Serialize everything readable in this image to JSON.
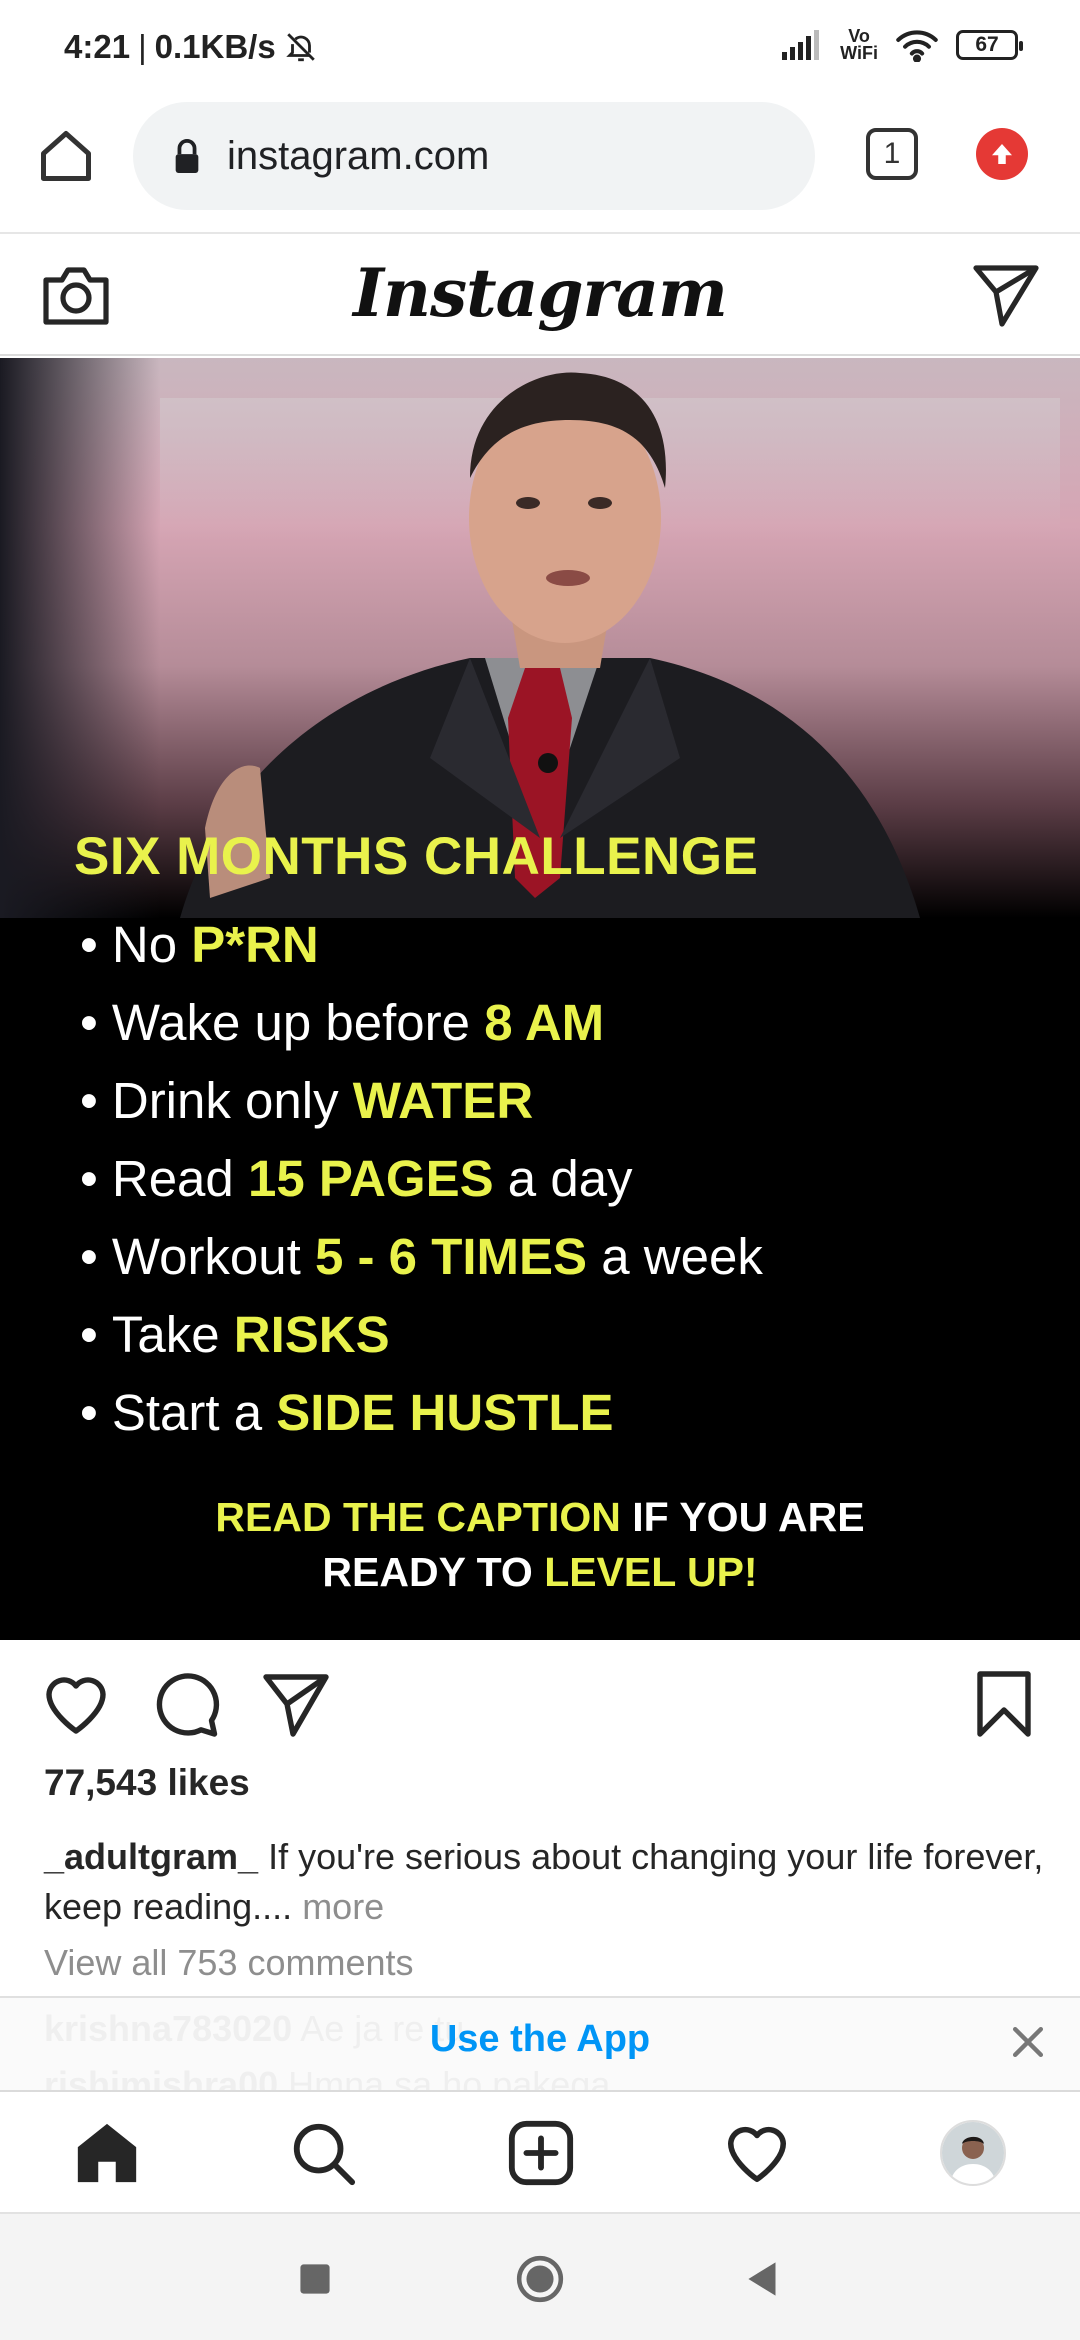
{
  "status_bar": {
    "time": "4:21",
    "network_speed": "0.1KB/s",
    "vowifi_line1": "Vo",
    "vowifi_line2": "WiFi",
    "battery": "67"
  },
  "browser": {
    "url": "instagram.com",
    "tab_count": "1"
  },
  "instagram": {
    "logo": "Instagram"
  },
  "post": {
    "title": "SIX MONTHS CHALLENGE",
    "items": [
      {
        "pre": "No",
        "hl": "P*RN",
        "post": ""
      },
      {
        "pre": "Wake up before",
        "hl": "8 AM",
        "post": ""
      },
      {
        "pre": "Drink only",
        "hl": "WATER",
        "post": ""
      },
      {
        "pre": "Read",
        "hl": "15 PAGES",
        "post": "a day"
      },
      {
        "pre": "Workout",
        "hl": "5 - 6 TIMES",
        "post": "a week"
      },
      {
        "pre": "Take",
        "hl": "RISKS",
        "post": ""
      },
      {
        "pre": "Start a",
        "hl": "SIDE HUSTLE",
        "post": ""
      }
    ],
    "cta_hl1": "READ THE CAPTION",
    "cta_text1": "IF YOU ARE",
    "cta_text2": "READY TO",
    "cta_hl2": "LEVEL UP!",
    "likes": "77,543 likes",
    "caption_user": "_adultgram_",
    "caption_text": "If you're serious about changing your life forever, keep reading....",
    "caption_more": "more",
    "view_comments": "View all 753 comments",
    "faded_comments": [
      {
        "user": "krishna783020",
        "text": "Ae ja re tu"
      },
      {
        "user": "rishimishra00",
        "text": "Hmna sa ho pakega"
      }
    ]
  },
  "banner": {
    "use_app": "Use the App"
  },
  "colors": {
    "highlight": "#e9f24c",
    "link_blue": "#0095f6",
    "update_red": "#e53935"
  },
  "icons": [
    "home-icon",
    "lock-icon",
    "tabs-icon",
    "update-icon",
    "camera-icon",
    "direct-message-icon",
    "heart-icon",
    "comment-icon",
    "share-icon",
    "bookmark-icon",
    "close-icon",
    "search-icon",
    "new-post-icon",
    "activity-icon",
    "recents-icon",
    "home-circle-icon",
    "back-icon"
  ]
}
